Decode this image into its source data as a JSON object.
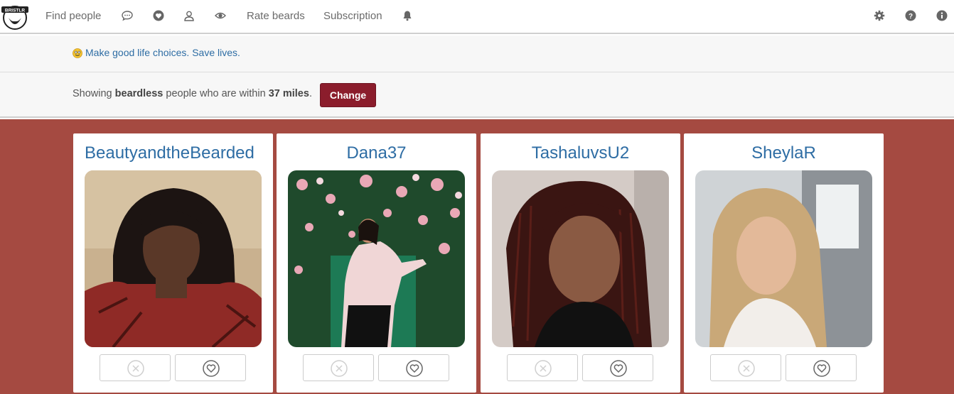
{
  "nav": {
    "logo_text": "BRISTLR",
    "find_people": "Find people",
    "rate_beards": "Rate beards",
    "subscription": "Subscription",
    "icons": [
      "chat-icon",
      "heart-icon",
      "user-icon",
      "eye-icon",
      "bell-icon",
      "gear-icon",
      "help-icon",
      "info-icon"
    ]
  },
  "message": {
    "text": "Make good life choices. Save lives."
  },
  "filter": {
    "prefix": "Showing ",
    "kind": "beardless",
    "middle": " people who are within ",
    "distance": "37 miles",
    "suffix": ".",
    "change_label": "Change"
  },
  "colors": {
    "accent": "#8b1d2c",
    "link": "#2e6da4",
    "results_bg": "#a54a41"
  },
  "people": [
    {
      "name": "BeautyandtheBearded"
    },
    {
      "name": "Dana37"
    },
    {
      "name": "TashaluvsU2"
    },
    {
      "name": "SheylaR"
    }
  ]
}
